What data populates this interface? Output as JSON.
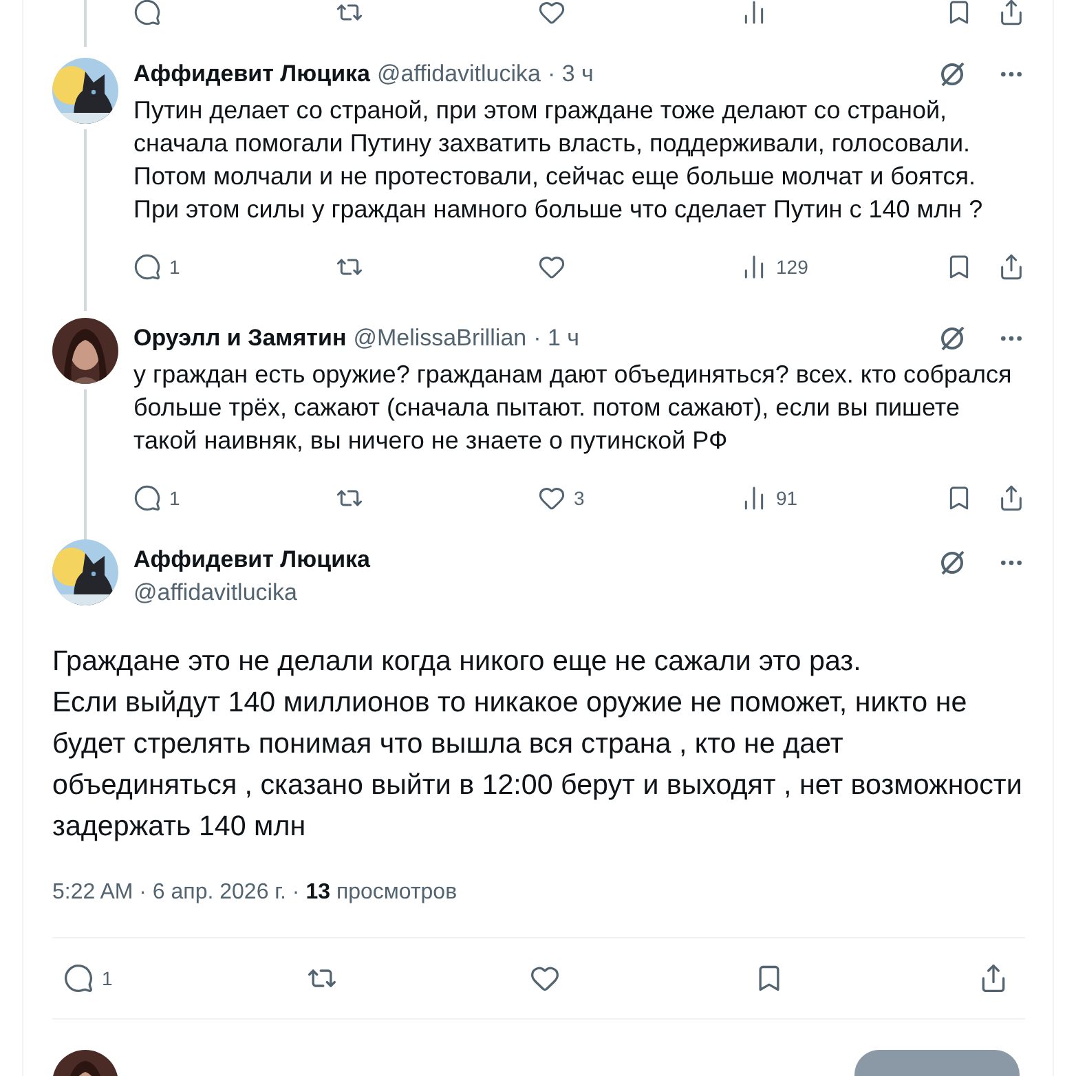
{
  "previous_actions": [
    {
      "kind": "reply"
    },
    {
      "kind": "repost"
    },
    {
      "kind": "like"
    },
    {
      "kind": "views"
    },
    {
      "kind": "bookmark"
    },
    {
      "kind": "share"
    }
  ],
  "replies": [
    {
      "name": "Аффидевит Люцика",
      "handle": "@affidavitlucika",
      "time": "· 3 ч",
      "text": "Путин делает со страной, при этом граждане тоже делают со страной, сначала помогали Путину захватить власть, поддерживали, голосовали. Потом молчали и не протестовали, сейчас еще больше молчат и боятся. При этом силы у граждан намного больше что сделает Путин с 140 млн ?",
      "actions": [
        {
          "kind": "reply",
          "count": "1"
        },
        {
          "kind": "repost"
        },
        {
          "kind": "like"
        },
        {
          "kind": "views",
          "count": "129"
        },
        {
          "kind": "bookmark"
        },
        {
          "kind": "share"
        }
      ]
    },
    {
      "name": "Оруэлл и Замятин",
      "handle": "@MelissaBrillian",
      "time": "· 1 ч",
      "text": "у граждан есть оружие? гражданам дают объединяться? всех. кто собрался больше трёх, сажают (сначала пытают. потом сажают), если вы пишете такой наивняк, вы ничего не знаете о путинской РФ",
      "actions": [
        {
          "kind": "reply",
          "count": "1"
        },
        {
          "kind": "repost"
        },
        {
          "kind": "like",
          "count": "3"
        },
        {
          "kind": "views",
          "count": "91"
        },
        {
          "kind": "bookmark"
        },
        {
          "kind": "share"
        }
      ]
    }
  ],
  "main": {
    "name": "Аффидевит Люцика",
    "handle": "@affidavitlucika",
    "paragraphs": [
      "Граждане это не делали когда никого еще не сажали это раз.",
      "Если выйдут 140 миллионов то никакое оружие не поможет, никто не будет стрелять понимая что вышла вся страна , кто не дает объединяться , сказано выйти в 12:00 берут и выходят , нет возможности задержать 140 млн"
    ],
    "meta": "5:22 AM · 6 апр. 2026 г. · **13** просмотров",
    "actions": [
      {
        "kind": "reply",
        "count": "1"
      },
      {
        "kind": "repost"
      },
      {
        "kind": "like"
      },
      {
        "kind": "bookmark"
      },
      {
        "kind": "share"
      }
    ]
  }
}
